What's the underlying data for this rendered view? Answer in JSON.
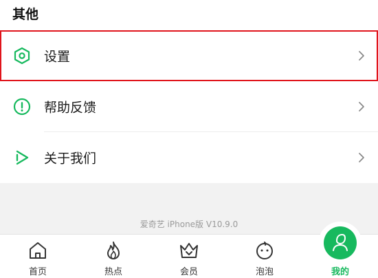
{
  "section": {
    "title": "其他"
  },
  "menu": {
    "items": [
      {
        "label": "设置",
        "icon": "settings-hexagon-icon",
        "highlighted": true
      },
      {
        "label": "帮助反馈",
        "icon": "help-exclamation-icon",
        "highlighted": false
      },
      {
        "label": "关于我们",
        "icon": "iqiyi-play-icon",
        "highlighted": false
      }
    ]
  },
  "footer": {
    "version": "爱奇艺 iPhone版 V10.9.0"
  },
  "tabbar": {
    "tabs": [
      {
        "label": "首页",
        "icon": "home-icon",
        "active": false
      },
      {
        "label": "热点",
        "icon": "flame-icon",
        "active": false
      },
      {
        "label": "会员",
        "icon": "crown-icon",
        "active": false
      },
      {
        "label": "泡泡",
        "icon": "bubble-face-icon",
        "active": false
      },
      {
        "label": "我的",
        "icon": "profile-icon",
        "active": true
      }
    ]
  },
  "colors": {
    "accent": "#17b95e",
    "highlight_border": "#e0141b",
    "text": "#1a1a1a",
    "muted": "#9a9a9a"
  }
}
